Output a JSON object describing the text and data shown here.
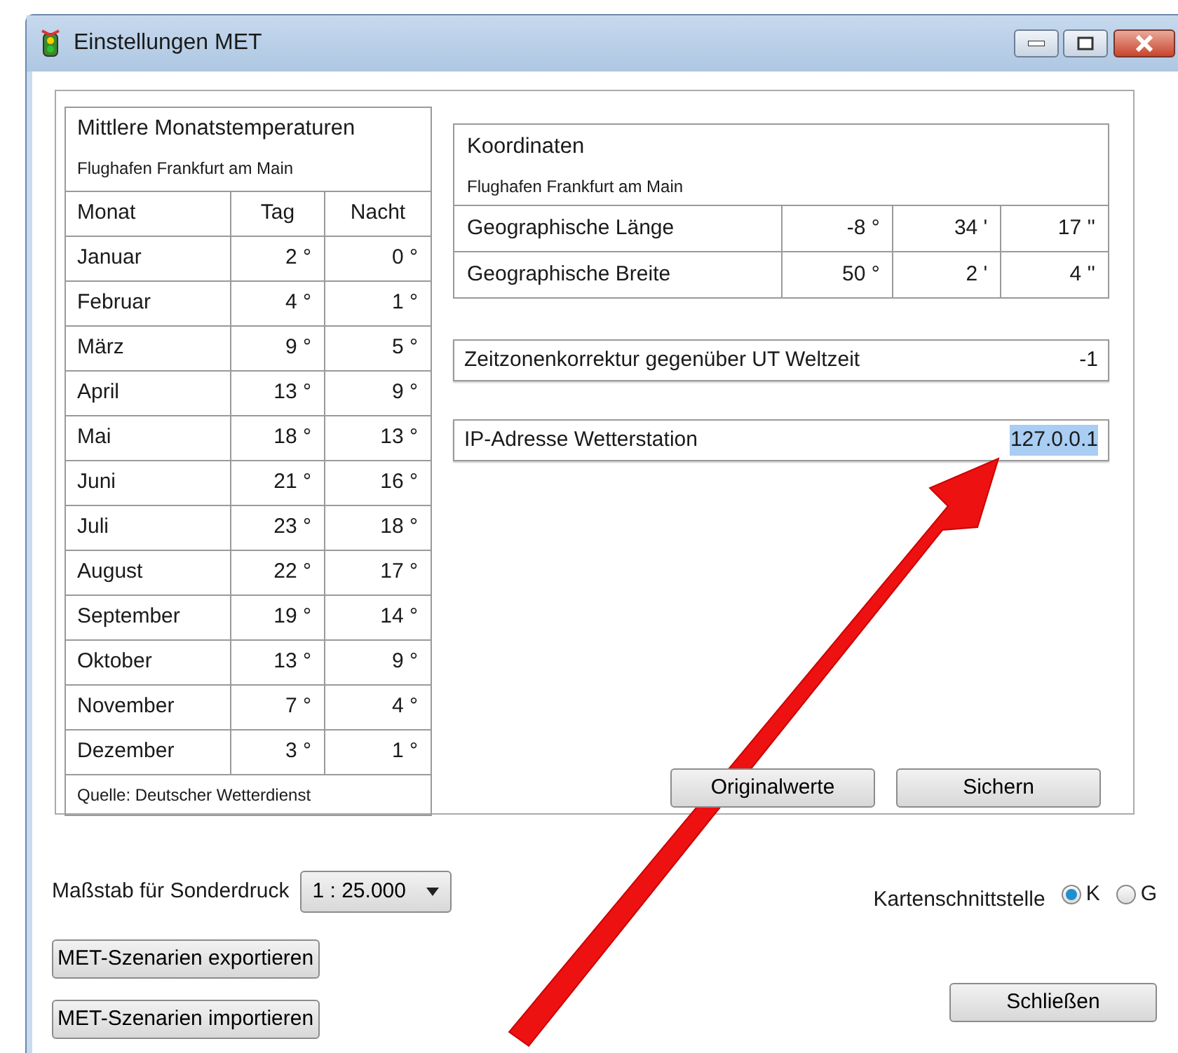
{
  "window": {
    "title": "Einstellungen MET"
  },
  "temperatures": {
    "title": "Mittlere Monatstemperaturen",
    "subtitle": "Flughafen Frankfurt am Main",
    "columns": [
      "Monat",
      "Tag",
      "Nacht"
    ],
    "rows": [
      {
        "month": "Januar",
        "day": "2 °",
        "night": "0 °"
      },
      {
        "month": "Februar",
        "day": "4 °",
        "night": "1 °"
      },
      {
        "month": "März",
        "day": "9 °",
        "night": "5 °"
      },
      {
        "month": "April",
        "day": "13 °",
        "night": "9 °"
      },
      {
        "month": "Mai",
        "day": "18 °",
        "night": "13 °"
      },
      {
        "month": "Juni",
        "day": "21 °",
        "night": "16 °"
      },
      {
        "month": "Juli",
        "day": "23 °",
        "night": "18 °"
      },
      {
        "month": "August",
        "day": "22 °",
        "night": "17 °"
      },
      {
        "month": "September",
        "day": "19 °",
        "night": "14 °"
      },
      {
        "month": "Oktober",
        "day": "13 °",
        "night": "9 °"
      },
      {
        "month": "November",
        "day": "7 °",
        "night": "4 °"
      },
      {
        "month": "Dezember",
        "day": "3 °",
        "night": "1 °"
      }
    ],
    "source": "Quelle: Deutscher Wetterdienst"
  },
  "coordinates": {
    "title": "Koordinaten",
    "subtitle": "Flughafen Frankfurt am Main",
    "rows": [
      {
        "label": "Geographische Länge",
        "degrees": "-8 °",
        "minutes": "34 '",
        "seconds": "17 ''"
      },
      {
        "label": "Geographische Breite",
        "degrees": "50 °",
        "minutes": "2 '",
        "seconds": "4 ''"
      }
    ]
  },
  "timezone": {
    "label": "Zeitzonenkorrektur gegenüber UT Weltzeit",
    "value": "-1"
  },
  "ip_address": {
    "label": "IP-Adresse Wetterstation",
    "value": "127.0.0.1",
    "highlighted": true
  },
  "group_buttons": [
    "Originalwerte",
    "Sichern"
  ],
  "scale": {
    "label": "Maßstab für Sonderdruck",
    "value": "1 : 25.000"
  },
  "map_interface": {
    "label": "Kartenschnittstelle",
    "options": [
      {
        "label": "K",
        "selected": true
      },
      {
        "label": "G",
        "selected": false
      }
    ]
  },
  "scenario_buttons": [
    "MET-Szenarien exportieren",
    "MET-Szenarien importieren"
  ],
  "close_button": "Schließen"
}
